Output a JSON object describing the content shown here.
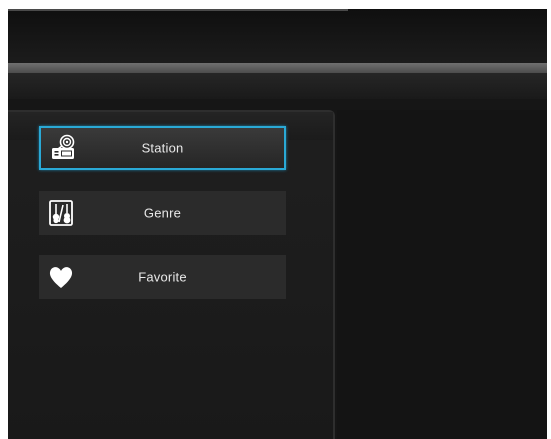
{
  "menu": {
    "items": [
      {
        "label": "Station",
        "icon": "radio-icon",
        "selected": true
      },
      {
        "label": "Genre",
        "icon": "guitar-genre-icon",
        "selected": false
      },
      {
        "label": "Favorite",
        "icon": "heart-icon",
        "selected": false
      }
    ]
  },
  "colors": {
    "background": "#161616",
    "item_background": "#2b2b2b",
    "selection_border": "#2aa9d6",
    "text": "#e8e8e8"
  }
}
